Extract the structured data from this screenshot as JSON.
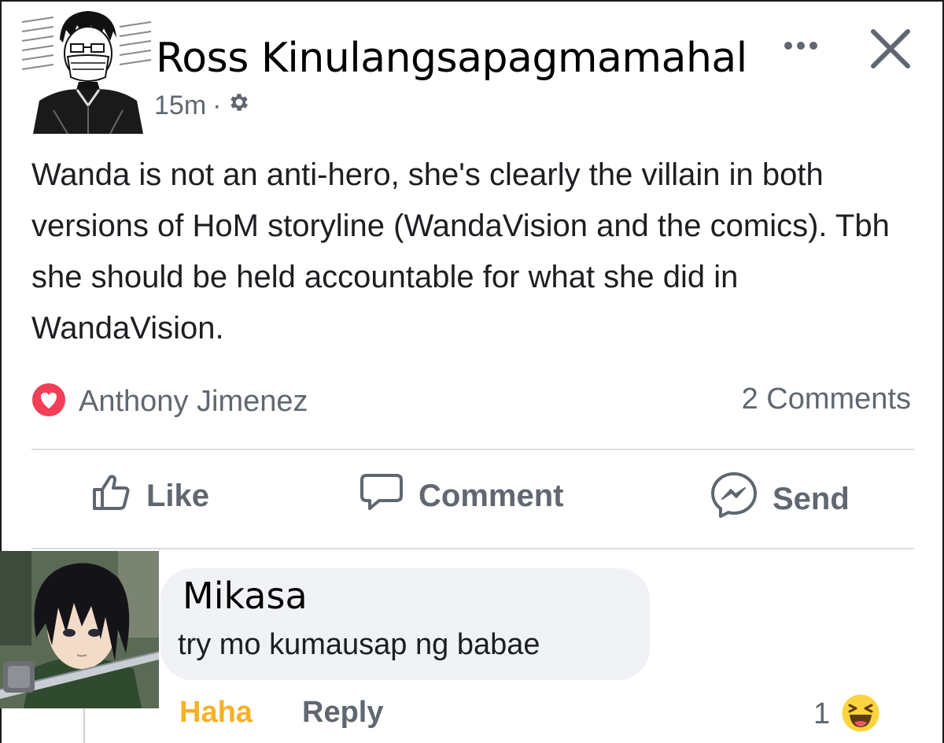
{
  "post": {
    "author": "Ross Kinulangsapagmamahal",
    "time": "15m",
    "separator": "·",
    "privacy_icon": "gear-icon",
    "text": "Wanda is not an anti-hero, she's clearly the villain in both versions of HoM storyline (WandaVision and the comics). Tbh she should be held accountable for what she did in WandaVision.",
    "reaction_icon": "love-reaction-icon",
    "reactor": "Anthony Jimenez",
    "comment_count": "2 Comments"
  },
  "actions": {
    "like": "Like",
    "comment": "Comment",
    "send": "Send"
  },
  "comment": {
    "author": "Mikasa",
    "text": "try mo kumausap ng babae",
    "haha_label": "Haha",
    "reply_label": "Reply",
    "reaction_count": "1",
    "reaction_icon": "haha-reaction-icon"
  },
  "colors": {
    "secondary_text": "#606770",
    "love": "#f33e58",
    "haha_label": "#f7b125",
    "bubble": "#f0f2f5",
    "divider": "#dadde1"
  }
}
